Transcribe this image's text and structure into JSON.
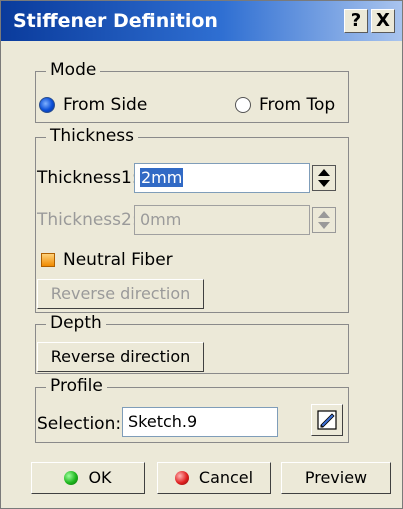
{
  "dialog": {
    "title": "Stiffener Definition",
    "help_label": "?",
    "close_label": "X"
  },
  "mode": {
    "legend": "Mode",
    "from_side": "From Side",
    "from_top": "From Top",
    "selected": "From Side"
  },
  "thickness": {
    "legend": "Thickness",
    "t1_label": "Thickness1:",
    "t1_value": "2mm",
    "t2_label": "Thickness2:",
    "t2_value": "0mm",
    "neutral_fiber_label": "Neutral Fiber",
    "reverse_label": "Reverse direction"
  },
  "depth": {
    "legend": "Depth",
    "reverse_label": "Reverse direction"
  },
  "profile": {
    "legend": "Profile",
    "selection_label": "Selection:",
    "selection_value": "Sketch.9"
  },
  "footer": {
    "ok": "OK",
    "cancel": "Cancel",
    "preview": "Preview"
  },
  "colors": {
    "title_start": "#0a3b9c",
    "title_end": "#a9c4ee",
    "selection_highlight": "#316ac5"
  }
}
